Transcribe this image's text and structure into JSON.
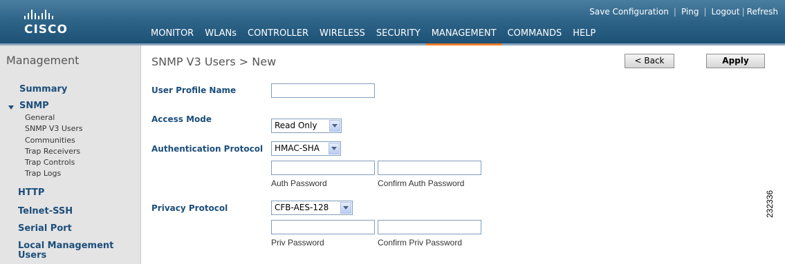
{
  "brand": {
    "name": "CISCO",
    "icon": "cisco-bridge-logo"
  },
  "colors": {
    "header": "#2f6589",
    "accent": "#f07d2c",
    "link": "#1c4e7a"
  },
  "top_links": {
    "save": "Save Configuration",
    "ping": "Ping",
    "logout": "Logout",
    "refresh": "Refresh"
  },
  "nav": {
    "monitor": "MONITOR",
    "wlans": "WLANs",
    "controller": "CONTROLLER",
    "wireless": "WIRELESS",
    "security": "SECURITY",
    "management": "MANAGEMENT",
    "commands": "COMMANDS",
    "help": "HELP",
    "active": "MANAGEMENT"
  },
  "sidebar": {
    "title": "Management",
    "summary": "Summary",
    "snmp": "SNMP",
    "snmp_items": [
      "General",
      "SNMP V3 Users",
      "Communities",
      "Trap Receivers",
      "Trap Controls",
      "Trap Logs"
    ],
    "http": "HTTP",
    "telnet": "Telnet-SSH",
    "serial": "Serial Port",
    "local_mgmt": "Local Management Users"
  },
  "page": {
    "title": "SNMP V3 Users > New",
    "back_label": "< Back",
    "apply_label": "Apply"
  },
  "form": {
    "user_profile_label": "User Profile Name",
    "user_profile_value": "",
    "access_mode_label": "Access Mode",
    "access_mode_value": "Read Only",
    "auth_protocol_label": "Authentication Protocol",
    "auth_protocol_value": "HMAC-SHA",
    "auth_password_label": "Auth Password",
    "confirm_auth_label": "Confirm Auth Password",
    "privacy_protocol_label": "Privacy Protocol",
    "privacy_protocol_value": "CFB-AES-128",
    "priv_password_label": "Priv Password",
    "confirm_priv_label": "Confirm Priv Password"
  },
  "figure_number": "232336"
}
